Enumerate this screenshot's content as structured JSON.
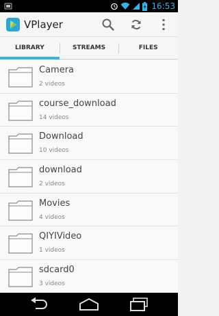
{
  "status_bar": {
    "time": "16:53",
    "icons": [
      "alarm-icon",
      "wifi-icon",
      "signal-icon",
      "battery-icon"
    ],
    "accent": "#33b5e5"
  },
  "app": {
    "title": "VPlayer",
    "logo_colors": [
      "#2aa7d8",
      "#8cc63e"
    ]
  },
  "actions": {
    "icons": [
      "search-icon",
      "refresh-icon",
      "overflow-menu-icon"
    ]
  },
  "tabs": [
    {
      "label": "LIBRARY",
      "active": true
    },
    {
      "label": "STREAMS",
      "active": false
    },
    {
      "label": "FILES",
      "active": false
    }
  ],
  "folders": [
    {
      "name": "Camera",
      "count": "2 videos"
    },
    {
      "name": "course_download",
      "count": "14 videos"
    },
    {
      "name": "Download",
      "count": "10 videos"
    },
    {
      "name": "download",
      "count": "2 videos"
    },
    {
      "name": "Movies",
      "count": "4 videos"
    },
    {
      "name": "QIYIVideo",
      "count": "1 videos"
    },
    {
      "name": "sdcard0",
      "count": "3 videos"
    }
  ],
  "nav_bar": {
    "icons": [
      "back-icon",
      "home-icon",
      "recent-apps-icon"
    ]
  }
}
